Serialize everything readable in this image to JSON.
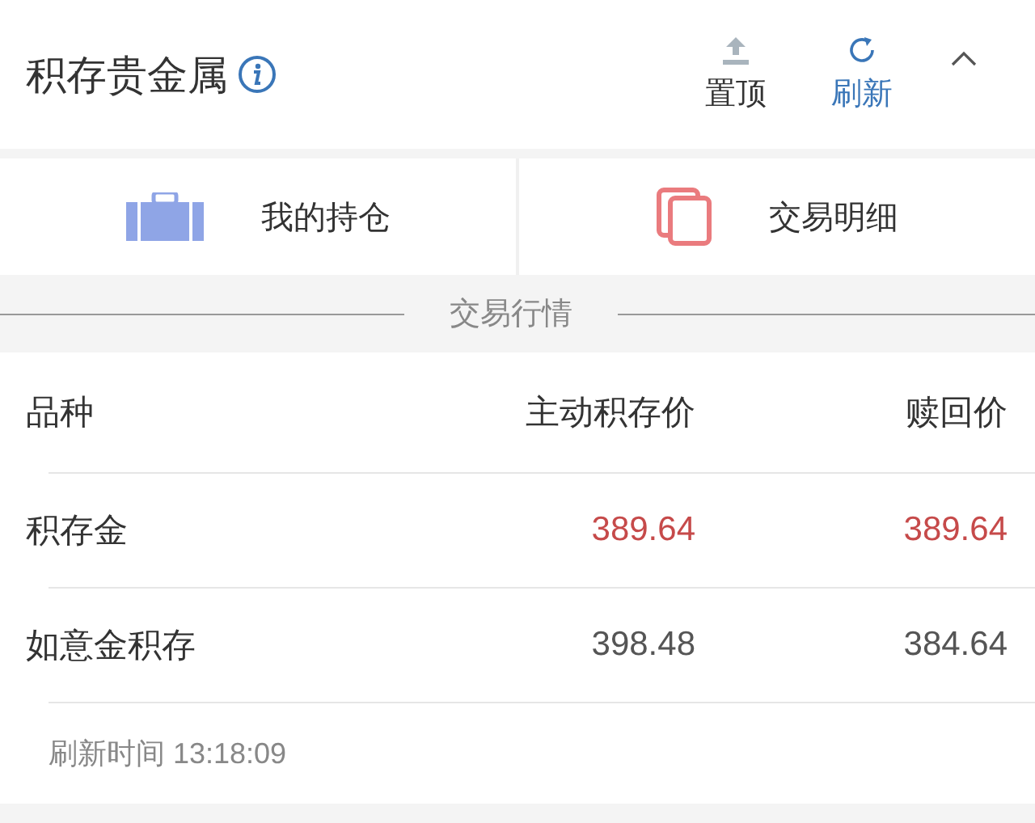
{
  "header": {
    "title": "积存贵金属",
    "actions": [
      {
        "kind": "pin",
        "label": "置顶"
      },
      {
        "kind": "refresh",
        "label": "刷新"
      }
    ],
    "expanded": true
  },
  "shortcuts": [
    {
      "kind": "holdings",
      "label": "我的持仓"
    },
    {
      "kind": "details",
      "label": "交易明细"
    }
  ],
  "section": {
    "title": "交易行情"
  },
  "table": {
    "columns": [
      "品种",
      "主动积存价",
      "赎回价"
    ],
    "rows": [
      {
        "cells": [
          "积存金",
          "389.64",
          "389.64"
        ],
        "highlighted": true
      },
      {
        "cells": [
          "如意金积存",
          "398.48",
          "384.64"
        ],
        "highlighted": false
      }
    ]
  },
  "refresh_time": "刷新时间 13:18:09"
}
